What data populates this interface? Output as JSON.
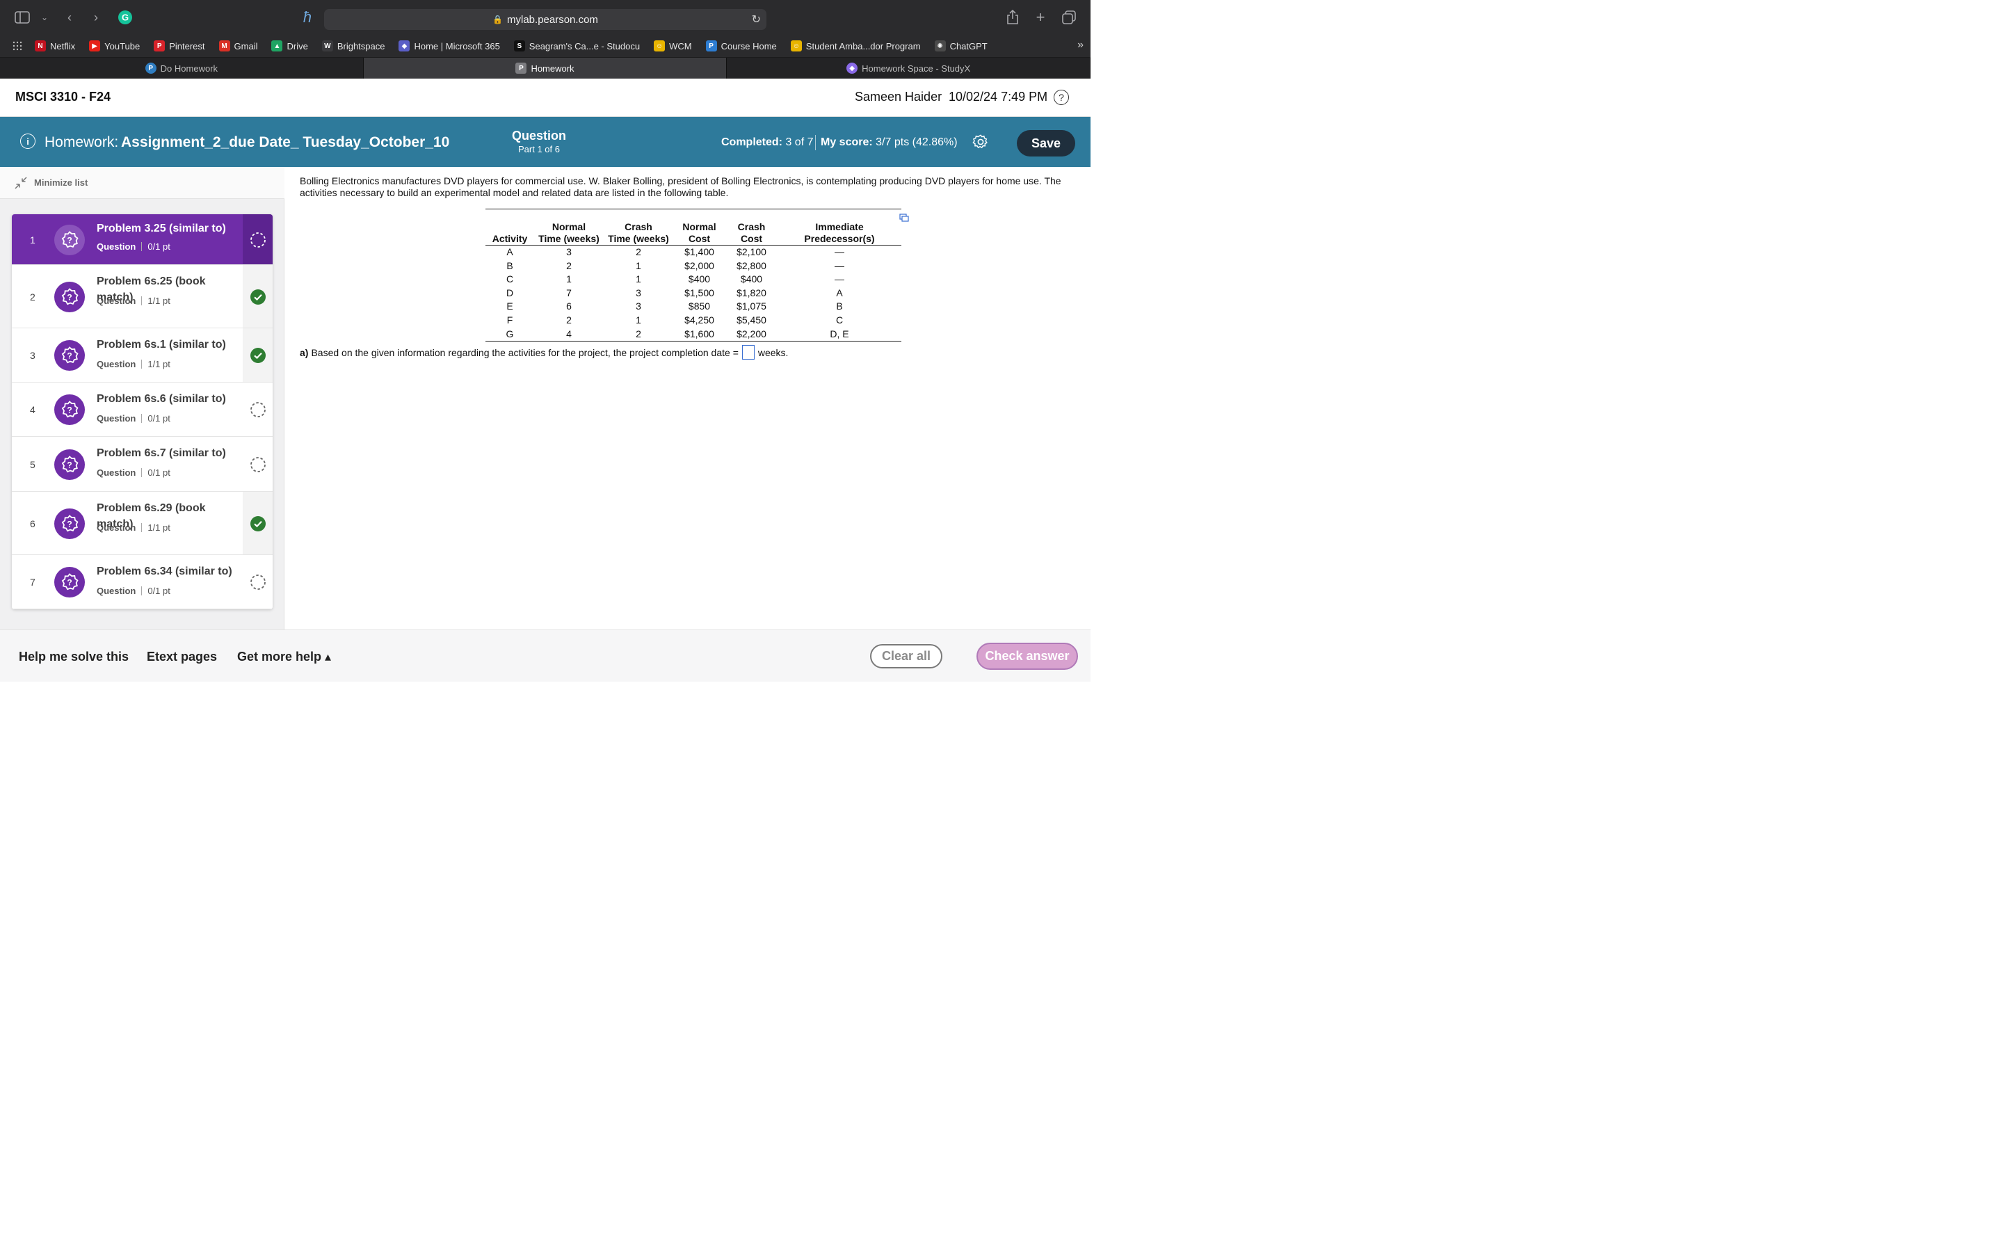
{
  "browser": {
    "url": "mylab.pearson.com",
    "bookmarks": [
      {
        "label": "Netflix",
        "icon": "netflix-icon",
        "color": "#c1121f",
        "glyph": "N"
      },
      {
        "label": "YouTube",
        "icon": "youtube-icon",
        "color": "#e62117",
        "glyph": "▶"
      },
      {
        "label": "Pinterest",
        "icon": "pinterest-icon",
        "color": "#d8232a",
        "glyph": "P"
      },
      {
        "label": "Gmail",
        "icon": "gmail-icon",
        "color": "#d93025",
        "glyph": "M"
      },
      {
        "label": "Drive",
        "icon": "drive-icon",
        "color": "#1fa463",
        "glyph": "▲"
      },
      {
        "label": "Brightspace",
        "icon": "brightspace-icon",
        "color": "#3a3a3d",
        "glyph": "W"
      },
      {
        "label": "Home | Microsoft 365",
        "icon": "microsoft365-icon",
        "color": "#5b5fc7",
        "glyph": "◆"
      },
      {
        "label": "Seagram's Ca...e - Studocu",
        "icon": "studocu-icon",
        "color": "#111111",
        "glyph": "S"
      },
      {
        "label": "WCM",
        "icon": "wcm-icon",
        "color": "#e8b400",
        "glyph": "☺"
      },
      {
        "label": "Course Home",
        "icon": "course-home-icon",
        "color": "#2d7dd2",
        "glyph": "P"
      },
      {
        "label": "Student Amba...dor Program",
        "icon": "student-ambassador-icon",
        "color": "#e8b400",
        "glyph": "☺"
      },
      {
        "label": "ChatGPT",
        "icon": "chatgpt-icon",
        "color": "#4a4a4a",
        "glyph": "✺"
      }
    ],
    "tabs": [
      {
        "label": "Do Homework",
        "icon": "pearson-icon",
        "color": "#2f7dc1",
        "glyph": "P",
        "active": false
      },
      {
        "label": "Homework",
        "icon": "homework-tab-icon",
        "color": "#7c7c80",
        "glyph": "P",
        "active": true
      },
      {
        "label": "Homework Space - StudyX",
        "icon": "studyx-icon",
        "color": "#8a6ae8",
        "glyph": "◆",
        "active": false
      }
    ]
  },
  "course": {
    "title": "MSCI 3310 - F24",
    "user": "Sameen Haider",
    "datetime": "10/02/24 7:49 PM"
  },
  "homework": {
    "label": "Homework:",
    "name": "Assignment_2_due Date_ Tuesday_October_10",
    "question_title": "Question",
    "question_part": "Part 1 of 6",
    "completed_label": "Completed:",
    "completed_value": "3 of 7",
    "score_label": "My score:",
    "score_value": "3/7 pts (42.86%)",
    "save_label": "Save"
  },
  "sidebar": {
    "minimize_label": "Minimize list",
    "problems": [
      {
        "num": "1",
        "title": "Problem 3.25 (similar to)",
        "type": "Question",
        "points": "0/1 pt",
        "status": "incomplete",
        "active": true
      },
      {
        "num": "2",
        "title": "Problem 6s.25 (book match)",
        "type": "Question",
        "points": "1/1 pt",
        "status": "complete",
        "active": false
      },
      {
        "num": "3",
        "title": "Problem 6s.1 (similar to)",
        "type": "Question",
        "points": "1/1 pt",
        "status": "complete",
        "active": false
      },
      {
        "num": "4",
        "title": "Problem 6s.6 (similar to)",
        "type": "Question",
        "points": "0/1 pt",
        "status": "incomplete",
        "active": false
      },
      {
        "num": "5",
        "title": "Problem 6s.7 (similar to)",
        "type": "Question",
        "points": "0/1 pt",
        "status": "incomplete",
        "active": false
      },
      {
        "num": "6",
        "title": "Problem 6s.29 (book match)",
        "type": "Question",
        "points": "1/1 pt",
        "status": "complete",
        "active": false
      },
      {
        "num": "7",
        "title": "Problem 6s.34 (similar to)",
        "type": "Question",
        "points": "0/1 pt",
        "status": "incomplete",
        "active": false
      }
    ]
  },
  "problem": {
    "text": "Bolling Electronics manufactures DVD players for commercial use. W. Blaker Bolling, president of Bolling Electronics, is contemplating producing DVD players for home use. The activities necessary to build an experimental model and related data are listed in the following table.",
    "table": {
      "headers": [
        {
          "line1": "",
          "line2": "Activity"
        },
        {
          "line1": "Normal",
          "line2": "Time (weeks)"
        },
        {
          "line1": "Crash",
          "line2": "Time (weeks)"
        },
        {
          "line1": "Normal",
          "line2": "Cost"
        },
        {
          "line1": "",
          "line2": "Crash Cost"
        },
        {
          "line1": "",
          "line2": "Immediate Predecessor(s)"
        }
      ],
      "rows": [
        [
          "A",
          "3",
          "2",
          "$1,400",
          "$2,100",
          "—"
        ],
        [
          "B",
          "2",
          "1",
          "$2,000",
          "$2,800",
          "—"
        ],
        [
          "C",
          "1",
          "1",
          "$400",
          "$400",
          "—"
        ],
        [
          "D",
          "7",
          "3",
          "$1,500",
          "$1,820",
          "A"
        ],
        [
          "E",
          "6",
          "3",
          "$850",
          "$1,075",
          "B"
        ],
        [
          "F",
          "2",
          "1",
          "$4,250",
          "$5,450",
          "C"
        ],
        [
          "G",
          "4",
          "2",
          "$1,600",
          "$2,200",
          "D, E"
        ]
      ]
    },
    "question_a_label": "a)",
    "question_a_text": "Based on the given information regarding the activities for the project, the project completion date =",
    "question_a_unit": "weeks.",
    "answer_value": ""
  },
  "footer": {
    "help_solve": "Help me solve this",
    "etext": "Etext pages",
    "more_help": "Get more help ▴",
    "clear_all": "Clear all",
    "check_answer": "Check answer"
  },
  "colors": {
    "homework_bar": "#2e7a9b",
    "active_problem": "#6f2da8",
    "complete_check": "#2e7d32",
    "save_button": "#1f2f3d",
    "check_answer": "#d8a2cf"
  }
}
